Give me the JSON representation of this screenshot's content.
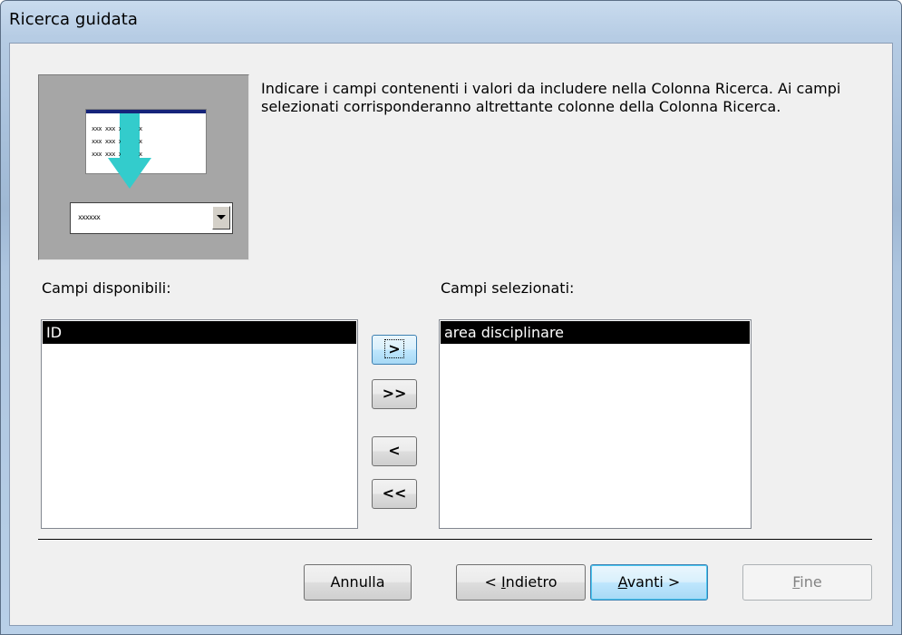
{
  "window": {
    "title": "Ricerca guidata"
  },
  "instruction": "Indicare i campi contenenti i valori da includere nella Colonna Ricerca. Ai campi selezionati corrisponderanno altrettante colonne della Colonna Ricerca.",
  "available": {
    "label": "Campi disponibili:",
    "items": [
      "ID"
    ]
  },
  "selected": {
    "label": "Campi selezionati:",
    "items": [
      "area disciplinare"
    ]
  },
  "move_buttons": {
    "add": ">",
    "add_all": ">>",
    "remove": "<",
    "remove_all": "<<"
  },
  "buttons": {
    "cancel": "Annulla",
    "back_prefix": "< ",
    "back_mnemonic": "I",
    "back_rest": "ndietro",
    "next_mnemonic": "A",
    "next_rest": "vanti >",
    "finish_mnemonic": "F",
    "finish_rest": "ine"
  },
  "illustration": {
    "cells": "xxx xxx xxx xxx",
    "combo_text": "xxxxxx"
  }
}
